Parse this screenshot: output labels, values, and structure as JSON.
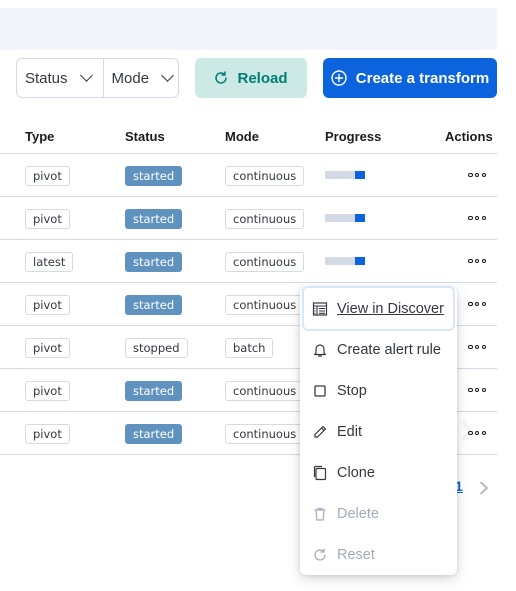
{
  "toolbar": {
    "filters": [
      {
        "label": "Status"
      },
      {
        "label": "Mode"
      }
    ],
    "reload_label": "Reload",
    "create_label": "Create a transform"
  },
  "table": {
    "columns": [
      "Type",
      "Status",
      "Mode",
      "Progress",
      "Actions"
    ],
    "rows": [
      {
        "type": "pivot",
        "status": "started",
        "mode": "continuous",
        "progress": 0.25
      },
      {
        "type": "pivot",
        "status": "started",
        "mode": "continuous",
        "progress": 0.25
      },
      {
        "type": "latest",
        "status": "started",
        "mode": "continuous",
        "progress": 0.25
      },
      {
        "type": "pivot",
        "status": "started",
        "mode": "continuous",
        "progress": 0.25
      },
      {
        "type": "pivot",
        "status": "stopped",
        "mode": "batch",
        "progress": null
      },
      {
        "type": "pivot",
        "status": "started",
        "mode": "continuous",
        "progress": 0.25
      },
      {
        "type": "pivot",
        "status": "started",
        "mode": "continuous",
        "progress": 0.25
      }
    ]
  },
  "pagination": {
    "current_page": "1"
  },
  "context_menu": {
    "items": [
      {
        "label": "View in Discover",
        "icon": "table-icon",
        "disabled": false
      },
      {
        "label": "Create alert rule",
        "icon": "bell-icon",
        "disabled": false
      },
      {
        "label": "Stop",
        "icon": "stop-icon",
        "disabled": false
      },
      {
        "label": "Edit",
        "icon": "pencil-icon",
        "disabled": false
      },
      {
        "label": "Clone",
        "icon": "copy-icon",
        "disabled": false
      },
      {
        "label": "Delete",
        "icon": "trash-icon",
        "disabled": true
      },
      {
        "label": "Reset",
        "icon": "refresh-icon",
        "disabled": true
      }
    ]
  },
  "colors": {
    "primary": "#0b64dd",
    "reload_bg": "#cce9e6",
    "reload_text": "#017d73",
    "status_started": "#6092c0",
    "disabled_text": "#a2abba"
  }
}
